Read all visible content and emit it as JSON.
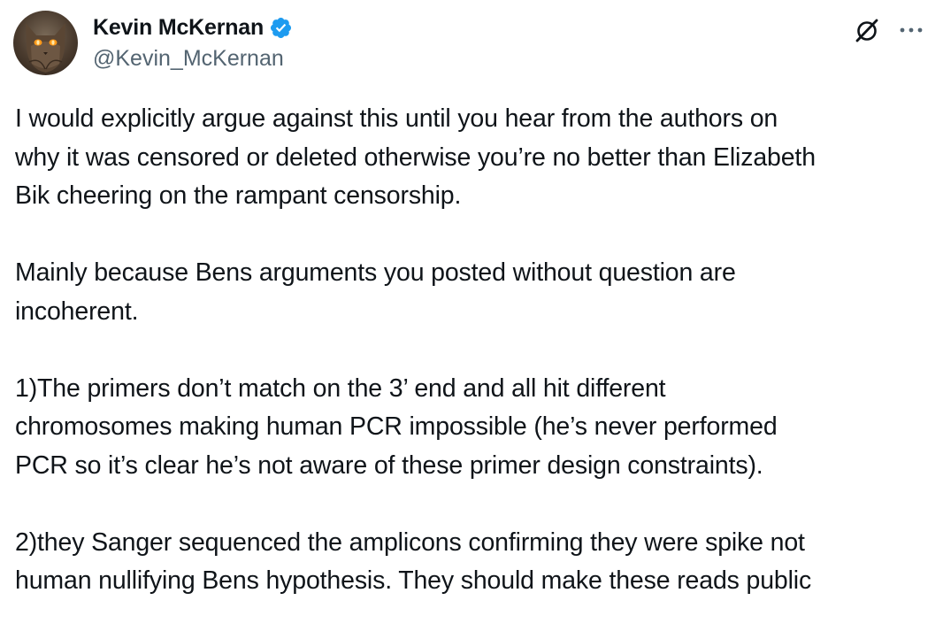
{
  "author": {
    "display_name": "Kevin McKernan",
    "handle": "@Kevin_McKernan",
    "verified": true,
    "verified_color": "#1d9bf0"
  },
  "actions": {
    "grok_icon": "grok-icon",
    "more_icon": "more-dots-icon"
  },
  "tweet": {
    "paragraphs": [
      "I would explicitly argue against this until you hear from the authors on\nwhy it was censored or deleted otherwise you’re no better than Elizabeth\nBik cheering on the rampant censorship.",
      "Mainly because Bens arguments you posted without question are\nincoherent.",
      "1)The primers don’t match on the 3’ end and all hit different\nchromosomes making human PCR impossible (he’s never performed\nPCR so it’s clear he’s not aware of these primer design constraints).",
      "2)they Sanger sequenced the amplicons confirming they were spike not\nhuman nullifying Bens hypothesis. They should make these reads public"
    ]
  }
}
